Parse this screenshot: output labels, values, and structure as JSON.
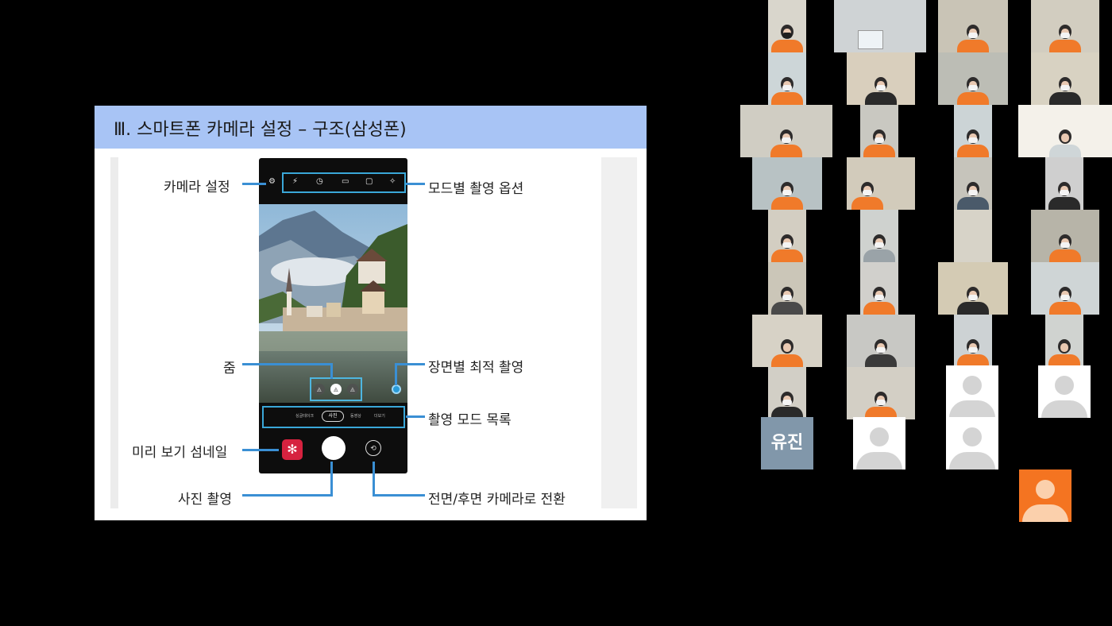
{
  "slide": {
    "title": "Ⅲ. 스마트폰 카메라 설정 – 구조(삼성폰)",
    "callouts": {
      "camera_settings": "카메라 설정",
      "mode_options": "모드별 촬영 옵션",
      "zoom": "줌",
      "scene_optimizer": "장면별 최적 촬영",
      "mode_list": "촬영 모드 목록",
      "preview_thumbnail": "미리 보기 섬네일",
      "take_photo": "사진 촬영",
      "switch_camera": "전면/후면 카메라로 전환"
    },
    "phone": {
      "modes": [
        "싱글테이크",
        "사진",
        "동영상",
        "더보기"
      ],
      "active_mode": "사진"
    }
  },
  "gallery": {
    "name_tile": "유진",
    "colors": {
      "accent_orange": "#f07a2a",
      "avatar_orange": "#f47421",
      "highlight_blue": "#3aa7d8"
    }
  }
}
